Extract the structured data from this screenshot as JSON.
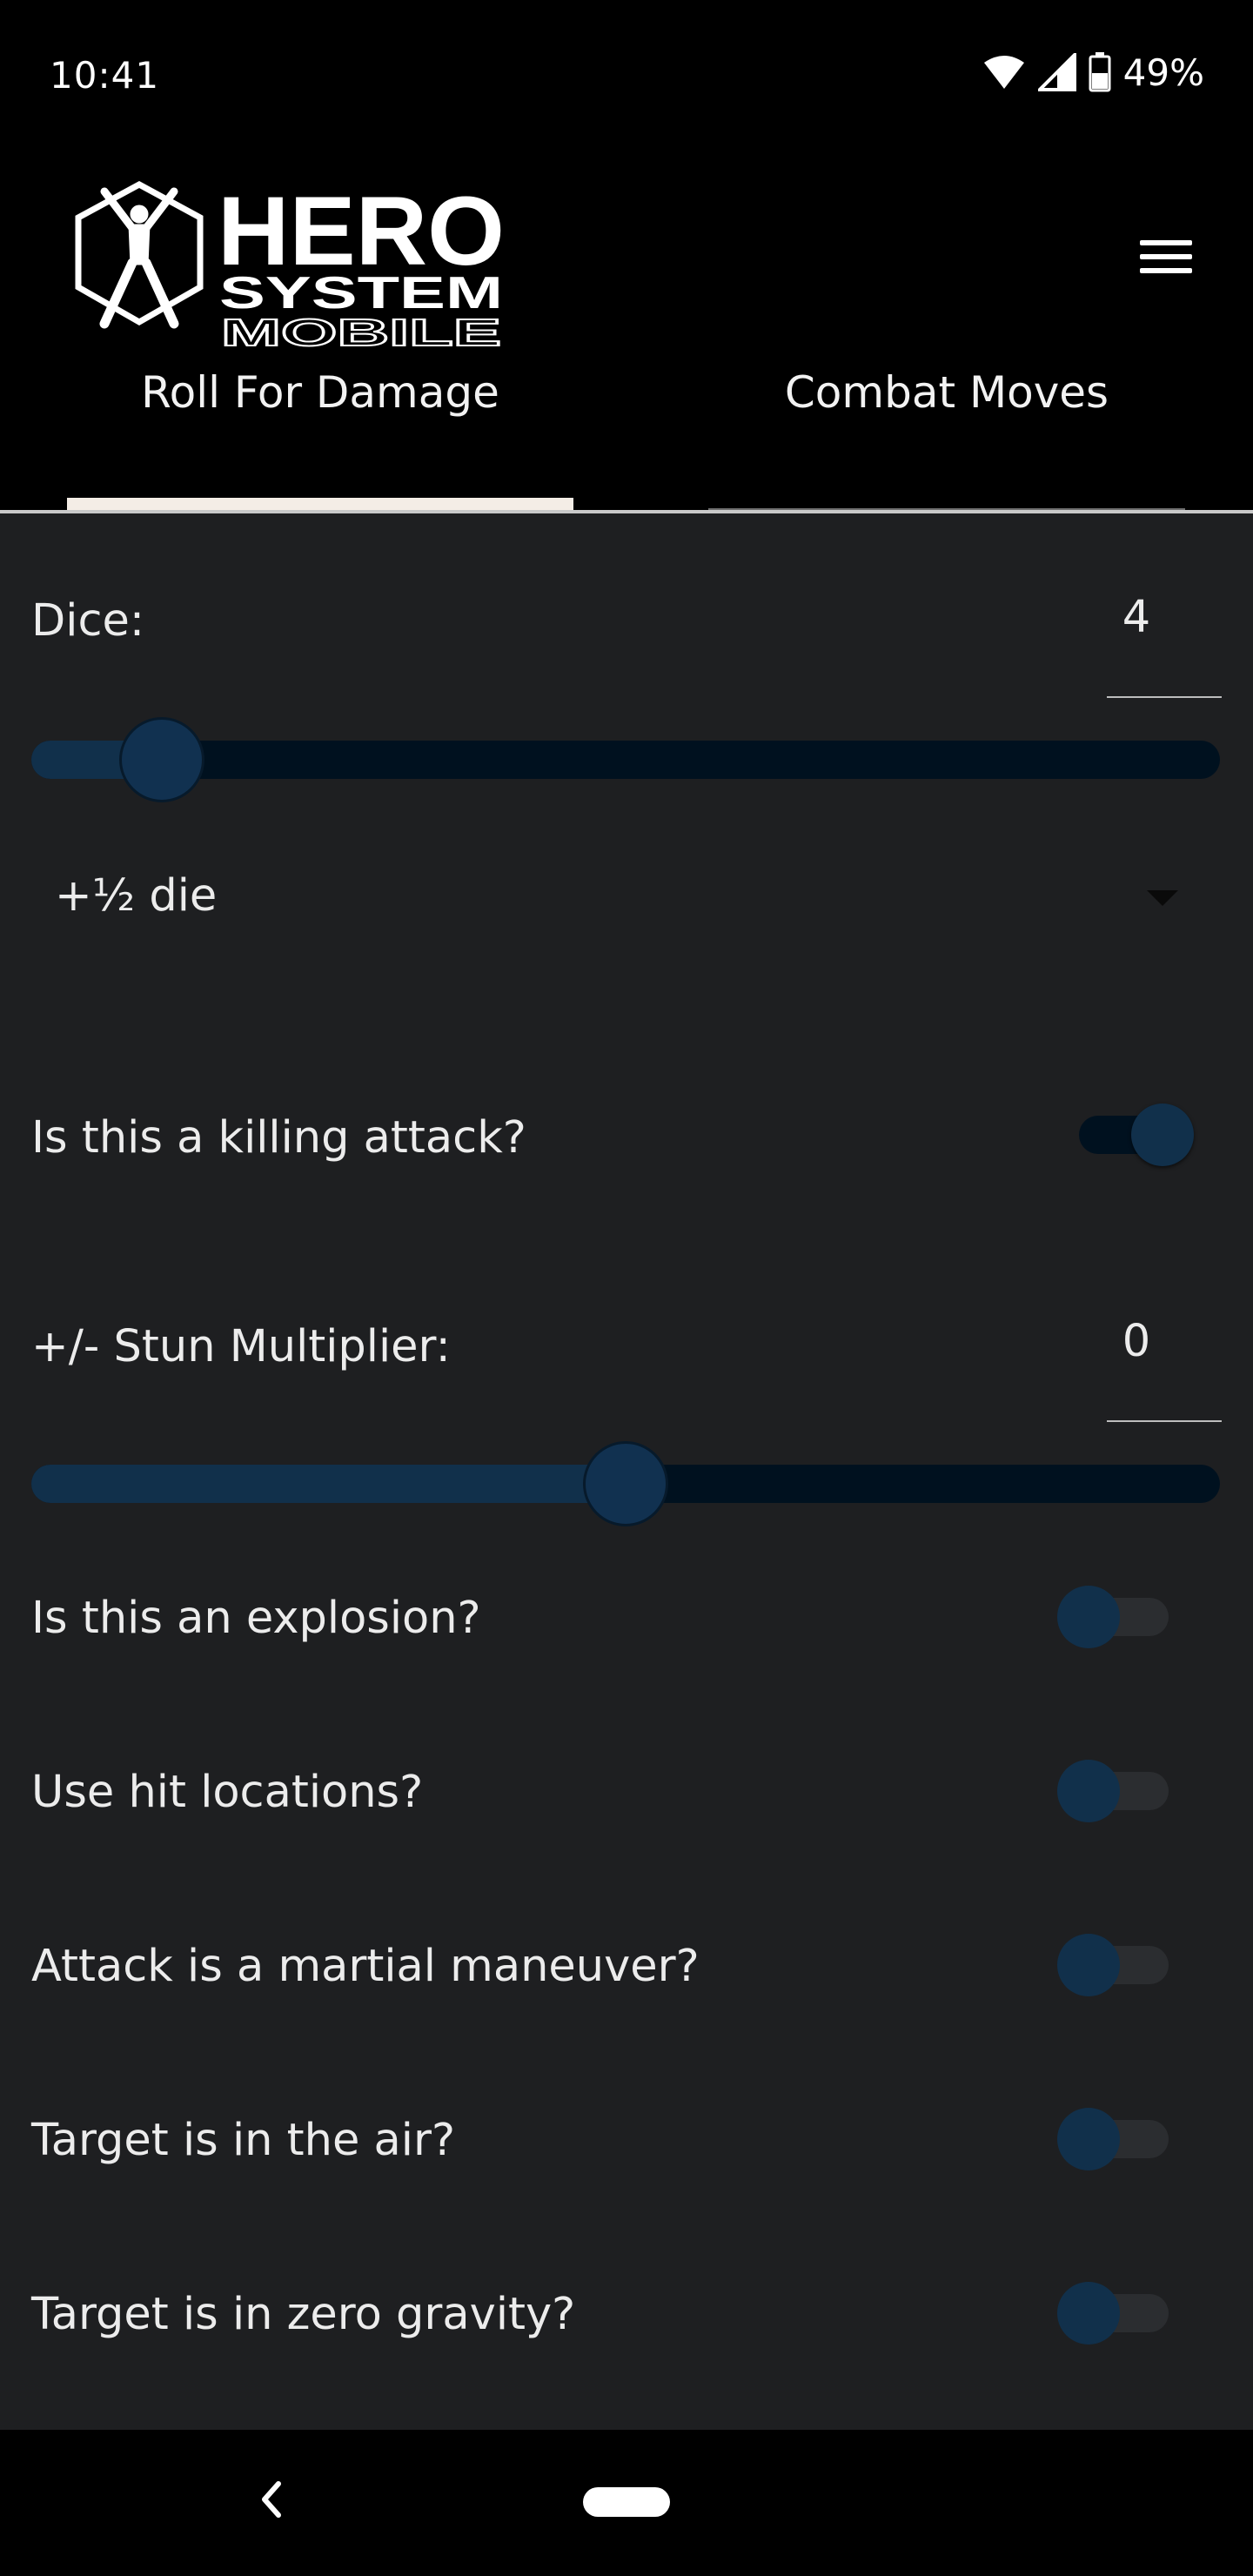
{
  "status_bar": {
    "time": "10:41",
    "battery": "49%",
    "icons": [
      "wifi-icon",
      "cell-signal-icon",
      "battery-icon"
    ]
  },
  "app": {
    "logo_text": {
      "line1": "HERO",
      "line2": "SYSTEM",
      "line3": "MOBILE"
    },
    "menu_icon": "hamburger-menu-icon"
  },
  "tabs": [
    {
      "label": "Roll For Damage",
      "active": true
    },
    {
      "label": "Combat Moves",
      "active": false
    }
  ],
  "form": {
    "dice": {
      "label": "Dice:",
      "value": "4",
      "slider_fraction": 0.11
    },
    "half_die": {
      "selected": "+½ die"
    },
    "killing_attack": {
      "label": "Is this a killing attack?",
      "on": true
    },
    "stun_multiplier": {
      "label": "+/- Stun Multiplier:",
      "value": "0",
      "slider_fraction": 0.5
    },
    "toggles": [
      {
        "label": "Is this an explosion?",
        "on": false
      },
      {
        "label": "Use hit locations?",
        "on": false
      },
      {
        "label": "Attack is a martial maneuver?",
        "on": false
      },
      {
        "label": "Target is in the air?",
        "on": false
      },
      {
        "label": "Target is in zero gravity?",
        "on": false
      }
    ]
  },
  "colors": {
    "background": "#1e1f21",
    "header": "#000000",
    "accent_dark_blue": "#11304b",
    "track_dark": "#00111f",
    "tab_indicator": "#f4ede6"
  }
}
